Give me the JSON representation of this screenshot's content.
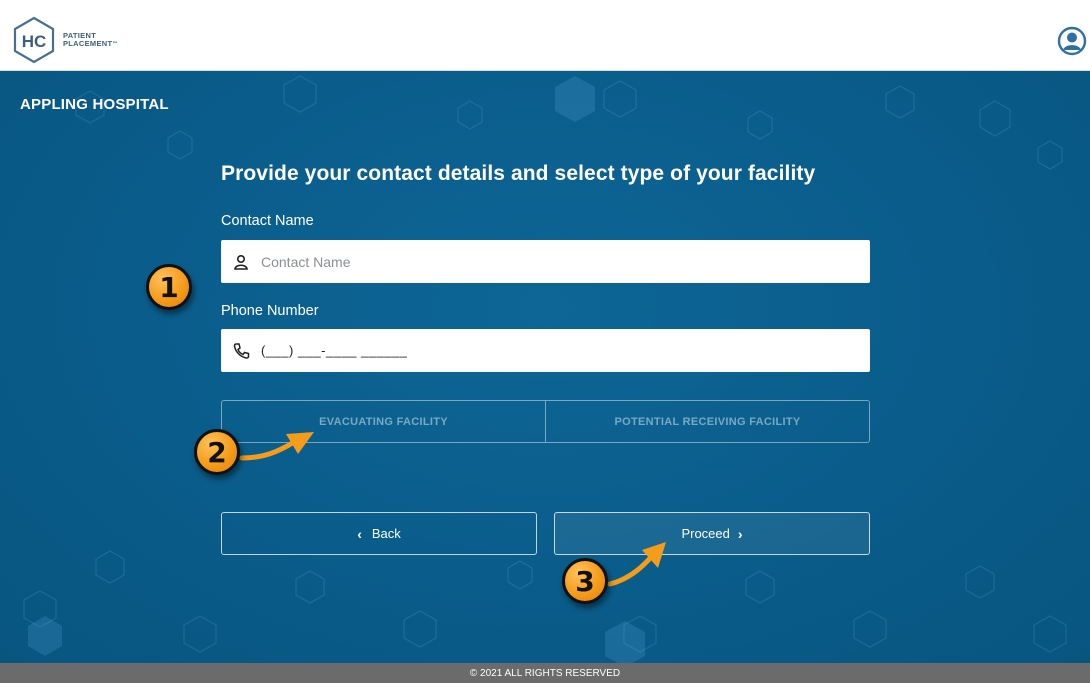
{
  "header": {
    "logo": {
      "mark": "HC",
      "line1": "PATIENT",
      "line2": "PLACEMENT",
      "tm": "™"
    },
    "user_icon": "user-circle-icon"
  },
  "main": {
    "hospital_name": "APPLING HOSPITAL",
    "heading": "Provide your contact details and select type of your facility",
    "contact_name": {
      "label": "Contact Name",
      "placeholder": "Contact Name",
      "value": "",
      "icon": "person-icon"
    },
    "phone_number": {
      "label": "Phone Number",
      "mask": "(___) ___-____ ______",
      "icon": "phone-icon"
    },
    "facility_type": {
      "options": [
        "EVACUATING FACILITY",
        "POTENTIAL RECEIVING FACILITY"
      ]
    },
    "buttons": {
      "back": "Back",
      "proceed": "Proceed",
      "back_chevron": "‹",
      "proceed_chevron": "›"
    }
  },
  "annotations": [
    "1",
    "2",
    "3"
  ],
  "footer": {
    "text": "© 2021 ALL RIGHTS RESERVED"
  },
  "colors": {
    "background": "#0a5c8a",
    "badge": "#f59c1a",
    "footer": "#6b6b6b",
    "logo": "#3d5f7a"
  }
}
